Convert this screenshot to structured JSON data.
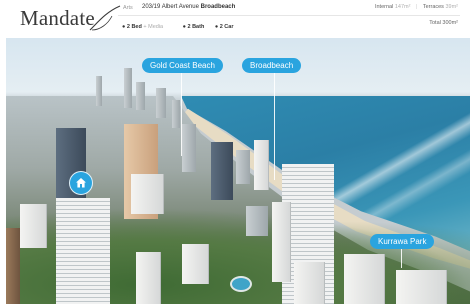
{
  "header": {
    "brand": "Mandate",
    "meta_label": "Arts",
    "address_prefix": "203/19 Albert Avenue",
    "address_suburb": "Broadbeach",
    "internal_label": "Internal",
    "internal_value": "147m²",
    "terraces_label": "Terraces",
    "terraces_value": "39m²",
    "beds": "2 Bed",
    "beds_sub": "+ Media",
    "baths": "2 Bath",
    "cars": "2 Car",
    "total": "Total 300m²"
  },
  "map": {
    "pins": [
      "Gold Coast Beach",
      "Broadbeach",
      "Kurrawa Park"
    ],
    "home_pin_icon": "home-icon"
  },
  "colors": {
    "pin_blue": "#2aa4df",
    "text_dark": "#333333"
  }
}
